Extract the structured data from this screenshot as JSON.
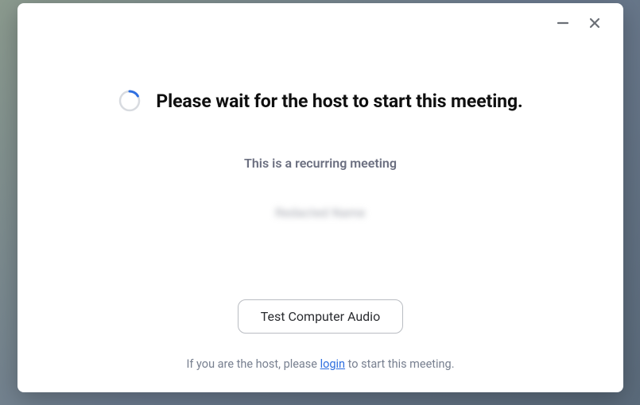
{
  "window": {
    "minimize_title": "Minimize",
    "close_title": "Close"
  },
  "main": {
    "heading": "Please wait for the host to start this meeting.",
    "subheading": "This is a recurring meeting",
    "meeting_name": "Redacted Name",
    "test_audio_label": "Test Computer Audio",
    "hint_prefix": "If you are the host, please ",
    "hint_link": "login",
    "hint_suffix": " to start this meeting."
  },
  "colors": {
    "accent": "#2f6fe0",
    "spinner_track": "#d8dbe0",
    "spinner_arc": "#2f6fe0"
  }
}
